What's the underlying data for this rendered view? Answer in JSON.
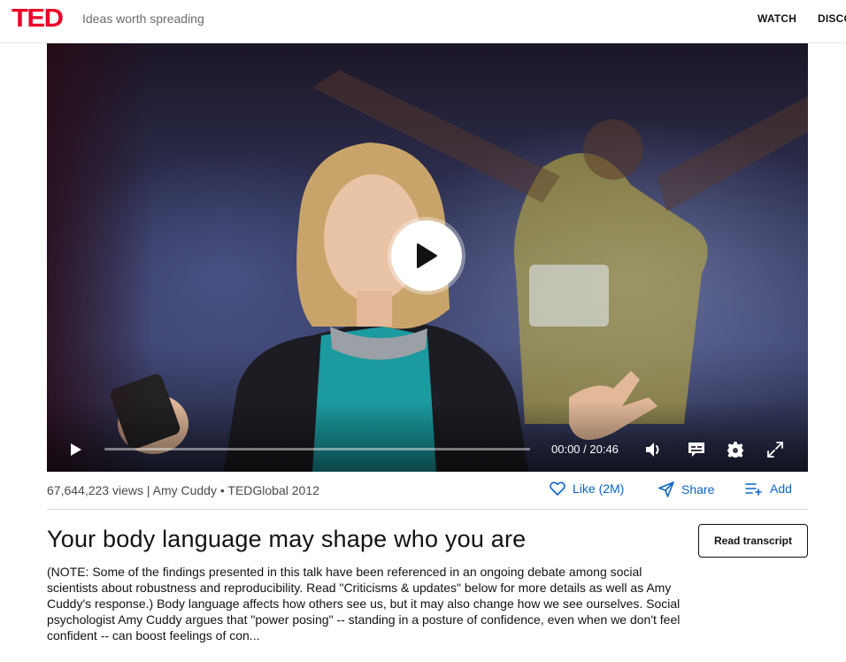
{
  "header": {
    "logo_text": "TED",
    "tagline": "Ideas worth spreading",
    "nav": {
      "watch": "WATCH",
      "discover": "DISCO"
    }
  },
  "player": {
    "time_display": "00:00 / 20:46",
    "progress_fraction": 0,
    "icons": {
      "big_play": "play-icon",
      "play": "play-icon",
      "volume": "volume-icon",
      "captions": "captions-icon",
      "settings": "gear-icon",
      "fullscreen": "fullscreen-icon"
    }
  },
  "talk": {
    "meta": "67,644,223 views | Amy Cuddy • TEDGlobal 2012",
    "title": "Your body language may shape who you are",
    "description": "(NOTE: Some of the findings presented in this talk have been referenced in an ongoing debate among social scientists about robustness and reproducibility. Read \"Criticisms & updates\" below for more details as well as Amy Cuddy's response.) Body language affects how others see us, but it may also change how we see ourselves. Social psychologist Amy Cuddy argues that \"power posing\" -- standing in a posture of confidence, even when we don't feel confident -- can boost feelings of con..."
  },
  "actions": {
    "like_label": "Like (2M)",
    "share_label": "Share",
    "add_label": "Add",
    "transcript_label": "Read transcript"
  },
  "colors": {
    "brand": "#eb0028",
    "action": "#0a63c9"
  }
}
